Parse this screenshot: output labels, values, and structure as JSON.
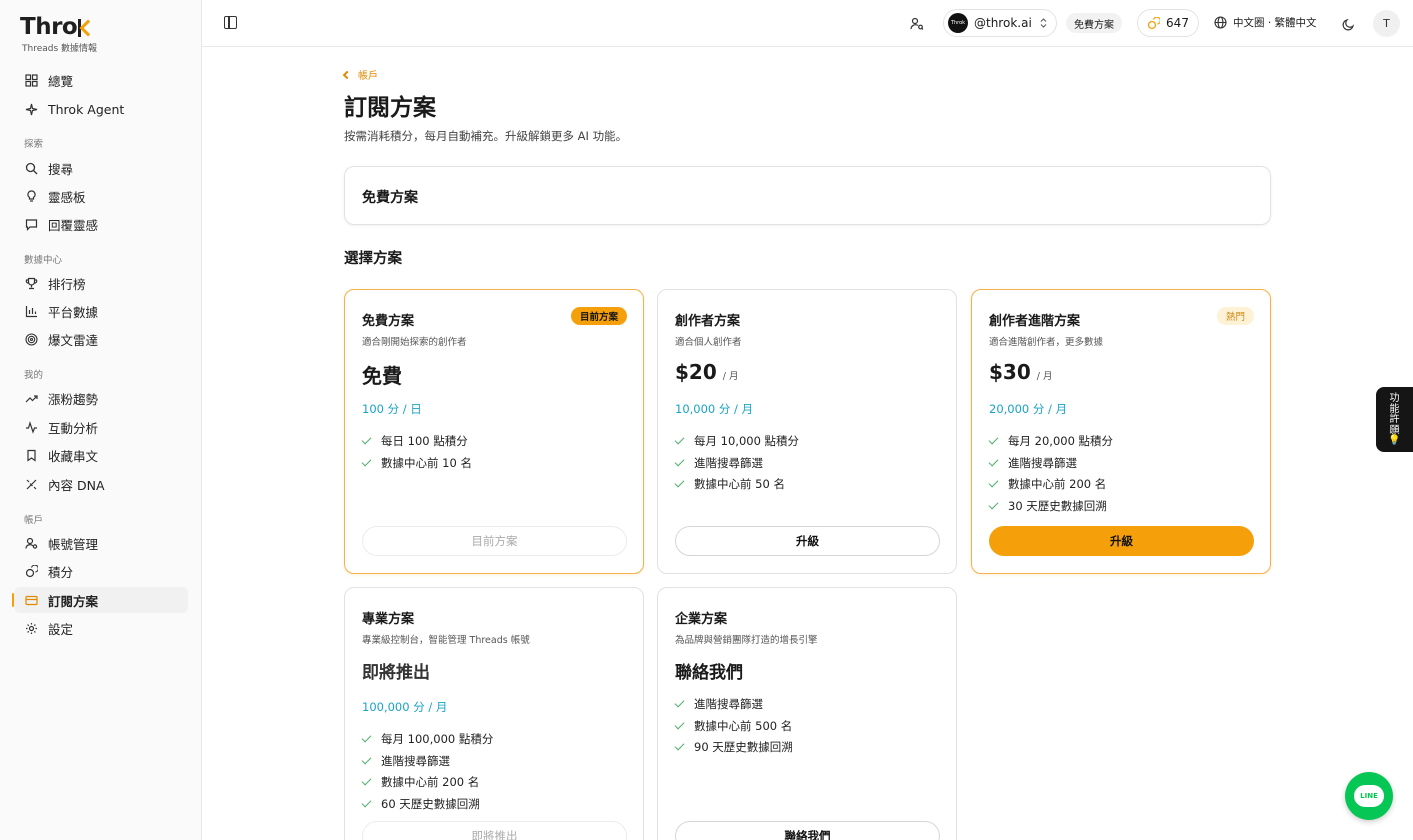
{
  "brand": {
    "logo_main": "Thro",
    "tagline": "Threads 數據情報"
  },
  "sidebar": {
    "top_items": [
      {
        "label": "總覽",
        "icon": "grid-icon"
      },
      {
        "label": "Throk Agent",
        "icon": "sparkle-icon"
      }
    ],
    "sections": [
      {
        "title": "探索",
        "items": [
          {
            "label": "搜尋",
            "icon": "search-icon"
          },
          {
            "label": "靈感板",
            "icon": "bulb-icon"
          },
          {
            "label": "回覆靈感",
            "icon": "reply-icon"
          }
        ]
      },
      {
        "title": "數據中心",
        "items": [
          {
            "label": "排行榜",
            "icon": "trophy-icon"
          },
          {
            "label": "平台數據",
            "icon": "bar-chart-icon"
          },
          {
            "label": "爆文雷達",
            "icon": "radar-icon"
          }
        ]
      },
      {
        "title": "我的",
        "items": [
          {
            "label": "漲粉趨勢",
            "icon": "trend-icon"
          },
          {
            "label": "互動分析",
            "icon": "activity-icon"
          },
          {
            "label": "收藏串文",
            "icon": "bookmark-icon"
          },
          {
            "label": "內容 DNA",
            "icon": "dna-icon"
          }
        ]
      },
      {
        "title": "帳戶",
        "items": [
          {
            "label": "帳號管理",
            "icon": "user-gear-icon"
          },
          {
            "label": "積分",
            "icon": "coins-icon"
          },
          {
            "label": "訂閱方案",
            "icon": "card-icon",
            "active": true
          },
          {
            "label": "設定",
            "icon": "gear-icon"
          }
        ]
      }
    ]
  },
  "topbar": {
    "account_avatar_text": "Throk",
    "account": "@throk.ai",
    "plan_chip": "免費方案",
    "credits": "647",
    "language": "中文圈 · 繁體中文",
    "user_initial": "T"
  },
  "main": {
    "back_label": "帳戶",
    "title": "訂閱方案",
    "description": "按需消耗積分，每月自動補充。升級解鎖更多 AI 功能。",
    "current_plan": "免費方案",
    "choose_title": "選擇方案"
  },
  "plans": [
    {
      "name": "免費方案",
      "badge": "目前方案",
      "subtitle": "適合剛開始探索的創作者",
      "price": "免費",
      "period": "",
      "credits": "100 分 / 日",
      "features": [
        "每日 100 點積分",
        "數據中心前 10 名"
      ],
      "button": "目前方案"
    },
    {
      "name": "創作者方案",
      "badge": "",
      "subtitle": "適合個人創作者",
      "price": "$20",
      "period": "/ 月",
      "credits": "10,000 分 / 月",
      "features": [
        "每月 10,000 點積分",
        "進階搜尋篩選",
        "數據中心前 50 名"
      ],
      "button": "升級"
    },
    {
      "name": "創作者進階方案",
      "badge": "熱門",
      "subtitle": "適合進階創作者，更多數據",
      "price": "$30",
      "period": "/ 月",
      "credits": "20,000 分 / 月",
      "features": [
        "每月 20,000 點積分",
        "進階搜尋篩選",
        "數據中心前 200 名",
        "30 天歷史數據回溯"
      ],
      "button": "升級"
    },
    {
      "name": "專業方案",
      "badge": "",
      "subtitle": "專業級控制台，智能管理 Threads 帳號",
      "price": "即將推出",
      "period": "",
      "credits": "100,000 分 / 月",
      "features": [
        "每月 100,000 點積分",
        "進階搜尋篩選",
        "數據中心前 200 名",
        "60 天歷史數據回溯"
      ],
      "button": "即將推出"
    },
    {
      "name": "企業方案",
      "badge": "",
      "subtitle": "為品牌與營銷團隊打造的增長引擎",
      "price": "聯絡我們",
      "period": "",
      "credits": "",
      "features": [
        "進階搜尋篩選",
        "數據中心前 500 名",
        "90 天歷史數據回溯"
      ],
      "button": "聯絡我們"
    }
  ],
  "side_tab": {
    "chars": [
      "功",
      "能",
      "許",
      "願"
    ],
    "emoji": "💡"
  },
  "line_button": "LINE"
}
